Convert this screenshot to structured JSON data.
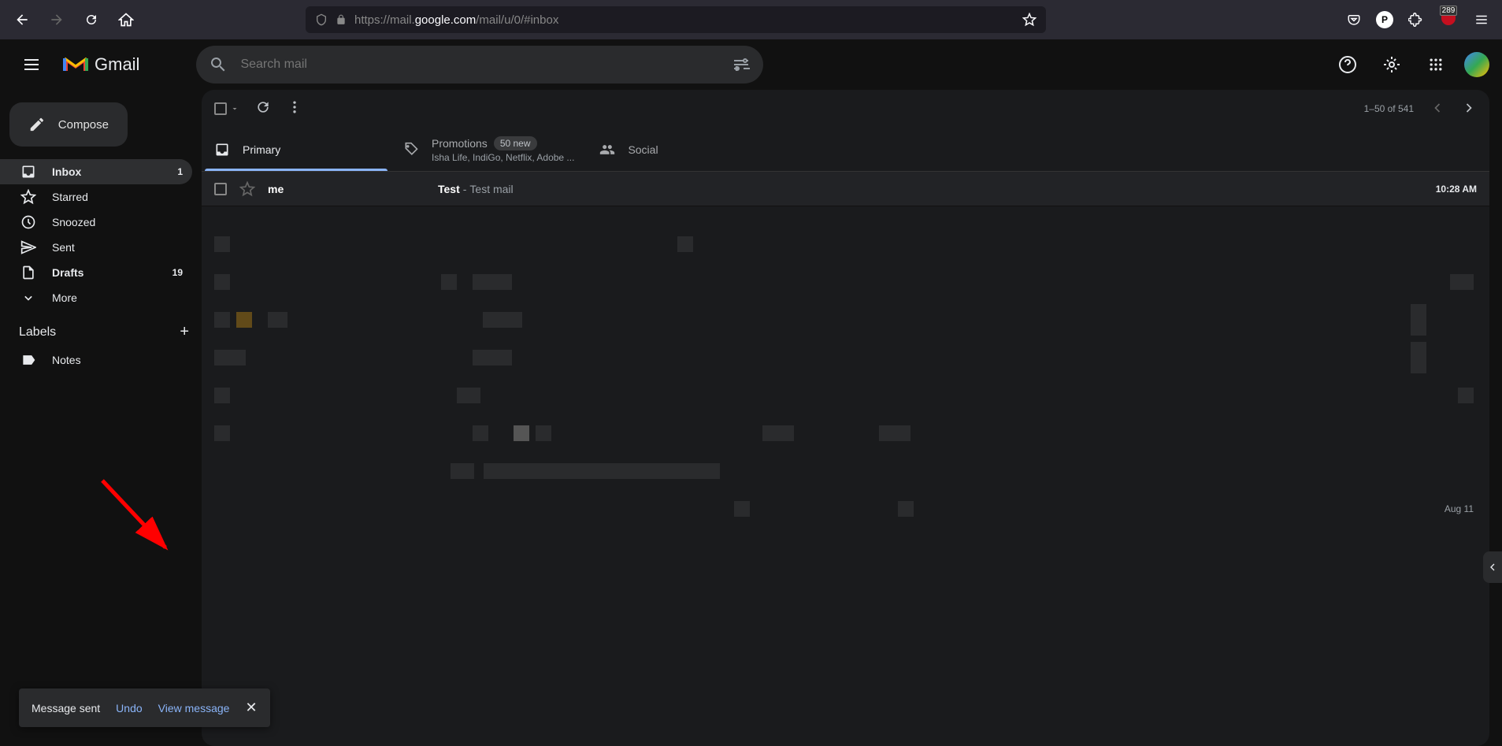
{
  "browser": {
    "url_prefix": "https://mail.",
    "url_domain": "google.com",
    "url_path": "/mail/u/0/#inbox",
    "ext_badge": "289"
  },
  "header": {
    "app_name": "Gmail",
    "search_placeholder": "Search mail"
  },
  "sidebar": {
    "compose": "Compose",
    "items": [
      {
        "label": "Inbox",
        "count": "1",
        "active": true,
        "bold": true
      },
      {
        "label": "Starred",
        "count": "",
        "active": false,
        "bold": false
      },
      {
        "label": "Snoozed",
        "count": "",
        "active": false,
        "bold": false
      },
      {
        "label": "Sent",
        "count": "",
        "active": false,
        "bold": false
      },
      {
        "label": "Drafts",
        "count": "19",
        "active": false,
        "bold": true
      },
      {
        "label": "More",
        "count": "",
        "active": false,
        "bold": false
      }
    ],
    "labels_header": "Labels",
    "labels": [
      {
        "label": "Notes"
      }
    ]
  },
  "toolbar": {
    "pagination": "1–50 of 541"
  },
  "tabs": {
    "primary": "Primary",
    "promotions": "Promotions",
    "promotions_badge": "50 new",
    "promotions_sub": "Isha Life, IndiGo, Netflix, Adobe ...",
    "social": "Social"
  },
  "emails": [
    {
      "sender": "me",
      "subject": "Test",
      "snippet": "Test mail",
      "time": "10:28 AM"
    }
  ],
  "placeholder_dates": {
    "d1": "Aug 11"
  },
  "toast": {
    "message": "Message sent",
    "undo": "Undo",
    "view": "View message"
  }
}
